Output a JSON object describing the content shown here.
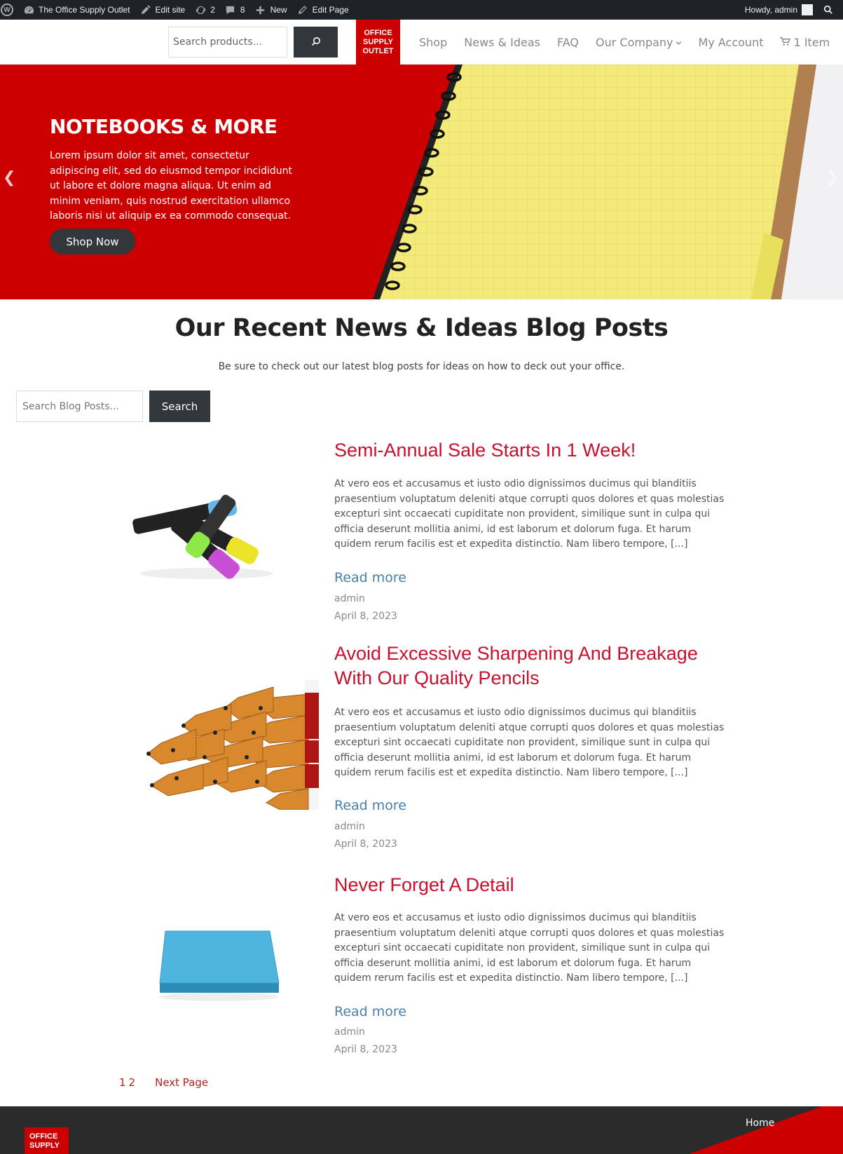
{
  "adminbar": {
    "site_name": "The Office Supply Outlet",
    "edit_site": "Edit site",
    "updates_count": "2",
    "comments_count": "8",
    "new_label": "New",
    "edit_page": "Edit Page",
    "howdy": "Howdy, admin"
  },
  "header": {
    "search_placeholder": "Search products...",
    "logo_line1": "OFFICE",
    "logo_line2": "SUPPLY",
    "logo_line3": "OUTLET",
    "nav": [
      "Shop",
      "News & Ideas",
      "FAQ",
      "Our Company",
      "My Account"
    ],
    "cart_label": "1 Item"
  },
  "hero": {
    "title": "NOTEBOOKS & MORE",
    "text": "Lorem ipsum dolor sit amet, consectetur adipiscing elit, sed do eiusmod tempor incididunt ut labore et dolore magna aliqua. Ut enim ad minim veniam, quis nostrud exercitation ullamco laboris nisi ut aliquip ex ea commodo consequat.",
    "button": "Shop Now"
  },
  "blog": {
    "title": "Our Recent News & Ideas Blog Posts",
    "subtitle": "Be sure to check out our latest blog posts for ideas on how to deck out your office.",
    "search_placeholder": "Search Blog Posts...",
    "search_button": "Search",
    "posts": [
      {
        "title": "Semi-Annual Sale Starts In 1 Week!",
        "excerpt": "At vero eos et accusamus et iusto odio dignissimos ducimus qui blanditiis praesentium voluptatum deleniti atque corrupti quos dolores et quas molestias excepturi sint occaecati cupiditate non provident, similique sunt in culpa qui officia deserunt mollitia animi, id est laborum et dolorum fuga. Et harum quidem rerum facilis est et expedita distinctio. Nam libero tempore, [...]",
        "read_more": "Read more",
        "author": "admin",
        "date": "April 8, 2023"
      },
      {
        "title": "Avoid Excessive Sharpening And Breakage With Our Quality Pencils",
        "excerpt": "At vero eos et accusamus et iusto odio dignissimos ducimus qui blanditiis praesentium voluptatum deleniti atque corrupti quos dolores et quas molestias excepturi sint occaecati cupiditate non provident, similique sunt in culpa qui officia deserunt mollitia animi, id est laborum et dolorum fuga. Et harum quidem rerum facilis est et expedita distinctio. Nam libero tempore, [...]",
        "read_more": "Read more",
        "author": "admin",
        "date": "April 8, 2023"
      },
      {
        "title": "Never Forget A Detail",
        "excerpt": "At vero eos et accusamus et iusto odio dignissimos ducimus qui blanditiis praesentium voluptatum deleniti atque corrupti quos dolores et quas molestias excepturi sint occaecati cupiditate non provident, similique sunt in culpa qui officia deserunt mollitia animi, id est laborum et dolorum fuga. Et harum quidem rerum facilis est et expedita distinctio. Nam libero tempore, [...]",
        "read_more": "Read more",
        "author": "admin",
        "date": "April 8, 2023"
      }
    ],
    "pagination": {
      "page1": "1",
      "page2": "2",
      "next": "Next Page"
    }
  },
  "footer": {
    "logo_line1": "OFFICE",
    "logo_line2": "SUPPLY",
    "home": "Home"
  },
  "colors": {
    "brand_red": "#cc0000",
    "dark": "#32373c",
    "admin_bar": "#1d2327",
    "link_blue": "#4a7fa8",
    "title_red": "#c8102e"
  },
  "icons": [
    "wordpress-icon",
    "dashboard-icon",
    "edit-icon",
    "updates-icon",
    "comments-icon",
    "plus-icon",
    "pencil-icon",
    "search-icon",
    "cart-icon",
    "chevron-down-icon",
    "chevron-left-icon",
    "chevron-right-icon"
  ]
}
